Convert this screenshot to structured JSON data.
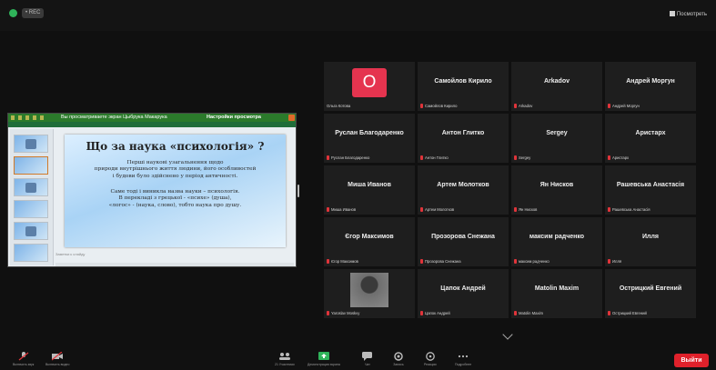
{
  "topbar": {
    "rec_badge": "• REC",
    "view_button": "Посмотреть"
  },
  "share": {
    "title_text": "Вы просматриваете экран Цыбрука Мaкарука",
    "options_label": "Настройки просмотра",
    "slide": {
      "title": "Що за наука «психологія» ?",
      "para1": [
        "Перші наукові узагальнення щодо",
        "природи внутрішнього життя людини, його особливостей",
        "і будови було здійснено у період античності."
      ],
      "para2": [
        "Саме тоді і виникла назва науки – психологія.",
        "В перекладі з грецької - «психе» (душа),",
        "«логос» - (наука, слово), тобто наука про душу."
      ]
    },
    "notes_text": "Заметки к слайду"
  },
  "participants": [
    {
      "name": "",
      "label": "Ольга Котова",
      "avatar": "О",
      "mic": false
    },
    {
      "name": "Самойлов Кирило",
      "label": "Самойлов Кирило",
      "mic": true
    },
    {
      "name": "Arkadov",
      "label": "Arkadov",
      "mic": true
    },
    {
      "name": "Андрей Моргун",
      "label": "Андрей Моргун",
      "mic": true
    },
    {
      "name": "Руслан Благодаренко",
      "label": "Руслан Благодаренко",
      "mic": true
    },
    {
      "name": "Антон Глитко",
      "label": "Антон Глитко",
      "mic": true
    },
    {
      "name": "Sergey",
      "label": "Sergey",
      "mic": true
    },
    {
      "name": "Аристарх",
      "label": "Аристарх",
      "mic": true
    },
    {
      "name": "Миша Иванов",
      "label": "Миша Иванов",
      "mic": true
    },
    {
      "name": "Артем Молотков",
      "label": "Артем Молотков",
      "mic": true
    },
    {
      "name": "Ян Нисков",
      "label": "Ян Нисков",
      "mic": true
    },
    {
      "name": "Рашевська Анастасія",
      "label": "Рашевська Анастасія",
      "mic": true
    },
    {
      "name": "Єгор Максимов",
      "label": "Єгор Максимов",
      "mic": true
    },
    {
      "name": "Прозорова Снежана",
      "label": "Прозорова Снежана",
      "mic": true
    },
    {
      "name": "максим радченко",
      "label": "максим радченко",
      "mic": true
    },
    {
      "name": "Илля",
      "label": "Илля",
      "mic": true
    },
    {
      "name": "",
      "label": "Yaroslav Moskvy",
      "photo": true,
      "mic": true
    },
    {
      "name": "Цапок Андрей",
      "label": "Цапок Андрей",
      "mic": true
    },
    {
      "name": "Matolin Maxim",
      "label": "Matolin Maxim",
      "mic": true
    },
    {
      "name": "Острицкий Евгений",
      "label": "Острицкий Евгений",
      "mic": true
    }
  ],
  "toolbar": {
    "audio_label": "Включить звук",
    "video_label": "Включить видео",
    "participants_count": "21",
    "participants_label": "Участники",
    "share_label": "Демонстрация экрана",
    "chat_label": "Чат",
    "record_label": "Запись",
    "reactions_label": "Реакции",
    "more_label": "Подробнее",
    "leave_label": "Выйти"
  },
  "colors": {
    "leave": "#e0212b",
    "avatar": "#e5344f",
    "share_frame": "#2b7a2b",
    "muted_mic": "#e0343a"
  }
}
